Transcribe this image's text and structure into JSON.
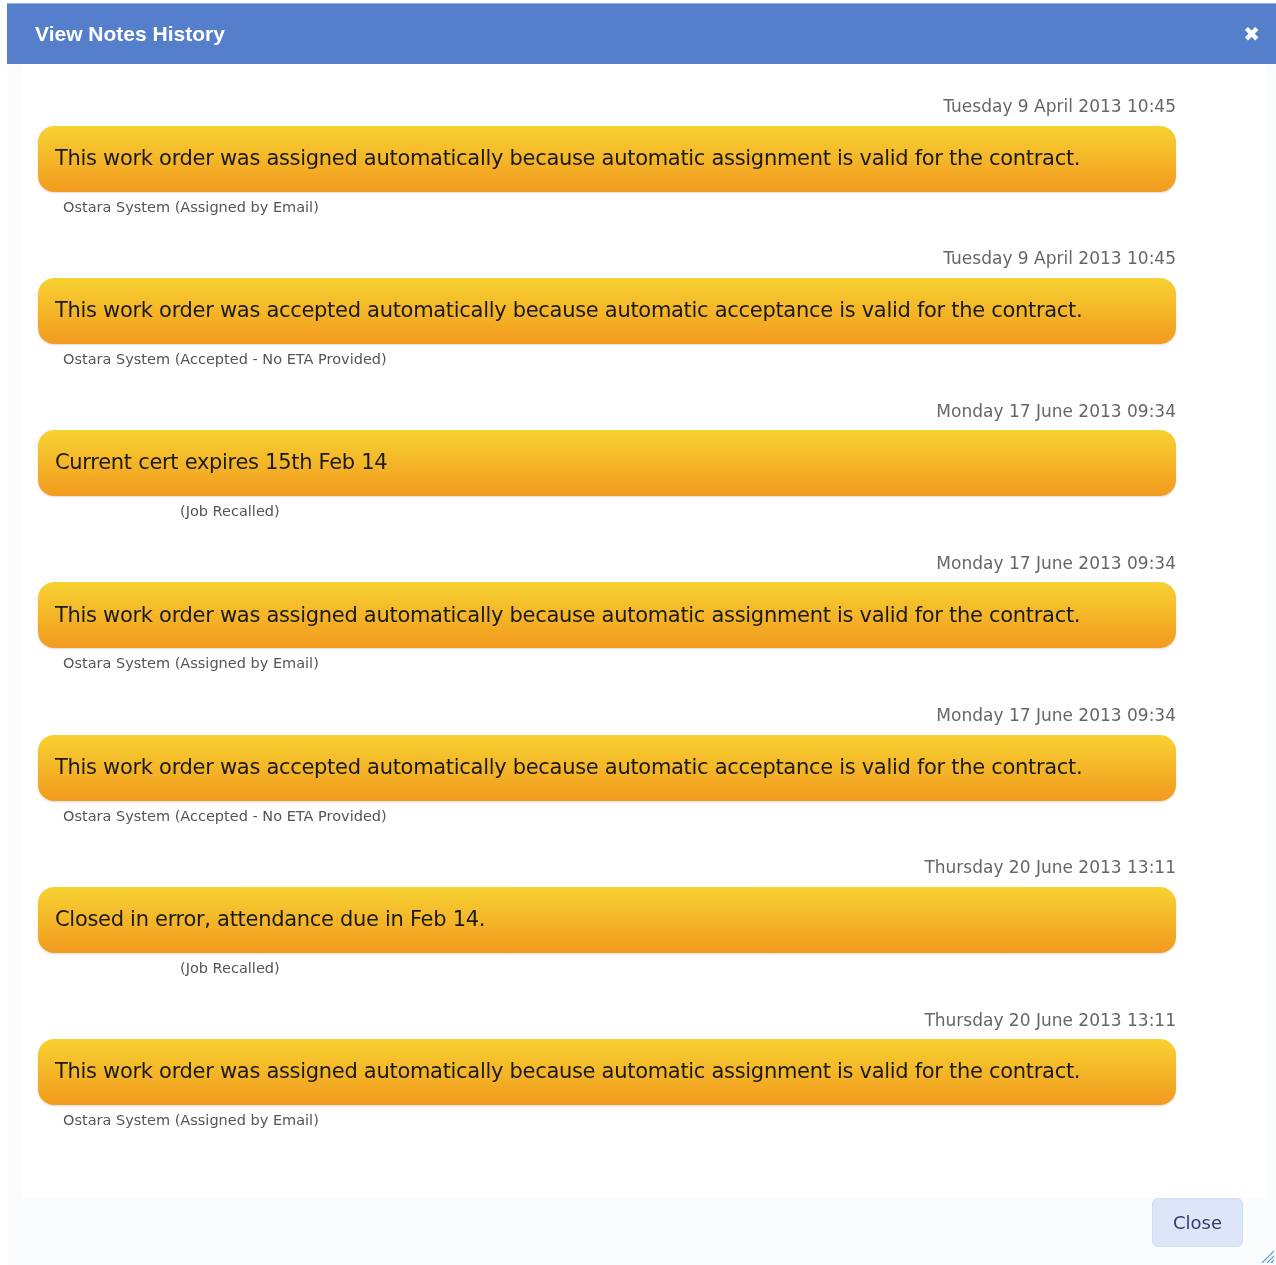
{
  "window": {
    "title": "View Notes History",
    "close_icon": "✖"
  },
  "notes": [
    {
      "kind": "system",
      "timestamp": "Tuesday 9 April 2013 10:45",
      "text": "This work order was assigned automatically because automatic assignment is valid for the contract.",
      "author": "Ostara System (Assigned by Email)"
    },
    {
      "kind": "system",
      "timestamp": "Tuesday 9 April 2013 10:45",
      "text": "This work order was accepted automatically because automatic acceptance is valid for the contract.",
      "author": "Ostara System (Accepted - No ETA Provided)"
    },
    {
      "kind": "recall",
      "timestamp": "Monday 17 June 2013 09:34",
      "text": "Current cert expires 15th Feb 14",
      "author": "(Job Recalled)"
    },
    {
      "kind": "system",
      "timestamp": "Monday 17 June 2013 09:34",
      "text": "This work order was assigned automatically because automatic assignment is valid for the contract.",
      "author": "Ostara System (Assigned by Email)"
    },
    {
      "kind": "system",
      "timestamp": "Monday 17 June 2013 09:34",
      "text": "This work order was accepted automatically because automatic acceptance is valid for the contract.",
      "author": "Ostara System (Accepted - No ETA Provided)"
    },
    {
      "kind": "recall",
      "timestamp": "Thursday 20 June 2013 13:11",
      "text": "Closed in error, attendance due in Feb 14.",
      "author": "(Job Recalled)"
    },
    {
      "kind": "system",
      "timestamp": "Thursday 20 June 2013 13:11",
      "text": "This work order was assigned automatically because automatic assignment is valid for the contract.",
      "author": "Ostara System (Assigned by Email)"
    }
  ],
  "buttons": [
    "Close"
  ]
}
